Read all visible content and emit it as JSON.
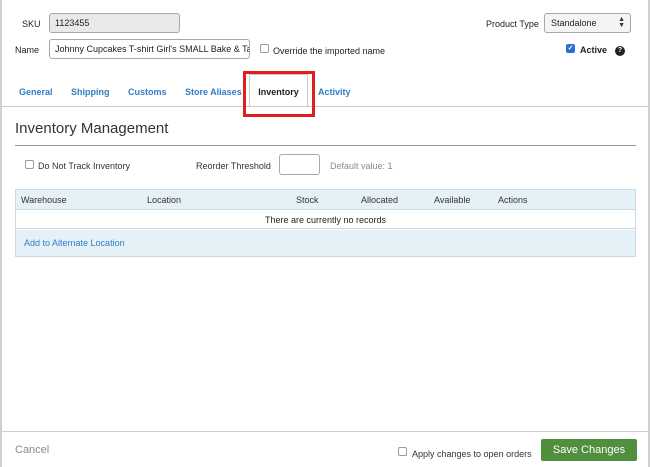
{
  "form": {
    "sku_label": "SKU",
    "sku_value": "1123455",
    "name_label": "Name",
    "name_value": "Johnny Cupcakes T-shirt Girl's SMALL Bake & Ta",
    "override_label": "Override the imported name",
    "product_type_label": "Product Type",
    "product_type_value": "Standalone",
    "active_label": "Active",
    "help_glyph": "?"
  },
  "tabs": [
    {
      "label": "General"
    },
    {
      "label": "Shipping"
    },
    {
      "label": "Customs"
    },
    {
      "label": "Store Aliases"
    },
    {
      "label": "Inventory",
      "active": true
    },
    {
      "label": "Activity"
    }
  ],
  "inventory": {
    "title": "Inventory Management",
    "do_not_track_label": "Do Not Track Inventory",
    "reorder_label": "Reorder Threshold",
    "reorder_value": "",
    "default_hint": "Default value: 1",
    "columns": [
      "Warehouse",
      "Location",
      "Stock",
      "Allocated",
      "Available",
      "Actions"
    ],
    "empty_message": "There are currently no records",
    "add_location_label": "Add to Alternate Location"
  },
  "footer": {
    "cancel_label": "Cancel",
    "apply_label": "Apply changes to open orders",
    "save_label": "Save Changes"
  },
  "colors": {
    "link": "#2f7ec5",
    "save_button": "#4f8f3e",
    "highlight": "#e11d1d",
    "table_header": "#e6f1f7",
    "checkbox_checked": "#2a6fd6"
  }
}
